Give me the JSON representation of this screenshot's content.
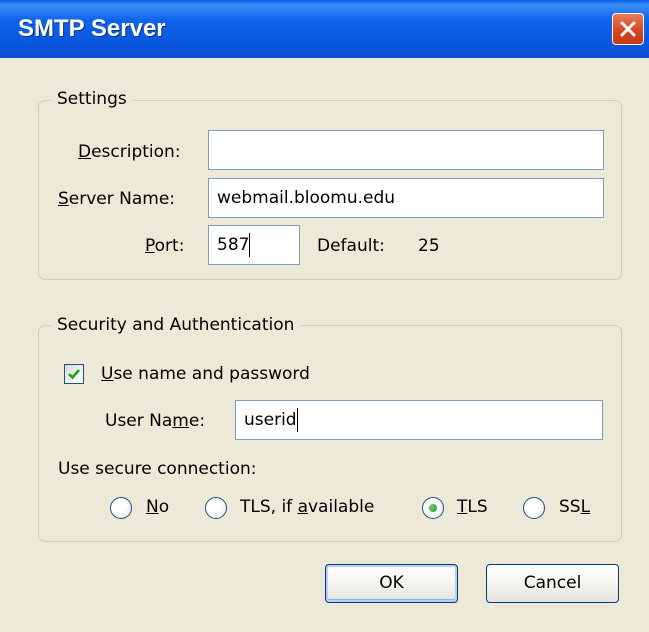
{
  "window": {
    "title": "SMTP Server"
  },
  "settings": {
    "legend": "Settings",
    "description": {
      "label_pre": "",
      "label_key": "D",
      "label_post": "escription:",
      "value": ""
    },
    "server_name": {
      "label_pre": "",
      "label_key": "S",
      "label_post": "erver Name:",
      "value": "webmail.bloomu.edu"
    },
    "port": {
      "label_pre": "",
      "label_key": "P",
      "label_post": "ort:",
      "value": "587",
      "default_label": "Default:",
      "default_value": "25"
    }
  },
  "security": {
    "legend": "Security and Authentication",
    "use_name_password": {
      "label_pre": "",
      "label_key": "U",
      "label_post": "se name and password",
      "checked": true
    },
    "user_name": {
      "label_pre": "User Na",
      "label_key": "m",
      "label_post": "e:",
      "value": "userid"
    },
    "secure_connection_label": "Use secure connection:",
    "options": [
      {
        "label_pre": "",
        "label_key": "N",
        "label_post": "o",
        "selected": false
      },
      {
        "label_pre": "TLS, if ",
        "label_key": "a",
        "label_post": "vailable",
        "selected": false
      },
      {
        "label_pre": "",
        "label_key": "T",
        "label_post": "LS",
        "selected": true
      },
      {
        "label_pre": "SS",
        "label_key": "L",
        "label_post": "",
        "selected": false
      }
    ]
  },
  "buttons": {
    "ok": "OK",
    "cancel": "Cancel"
  },
  "colors": {
    "title_bar": "#0A58E0",
    "close_button": "#D5441F",
    "dialog_bg": "#ECE9D8",
    "input_border": "#7F9DB9",
    "check_mark": "#21A121"
  }
}
